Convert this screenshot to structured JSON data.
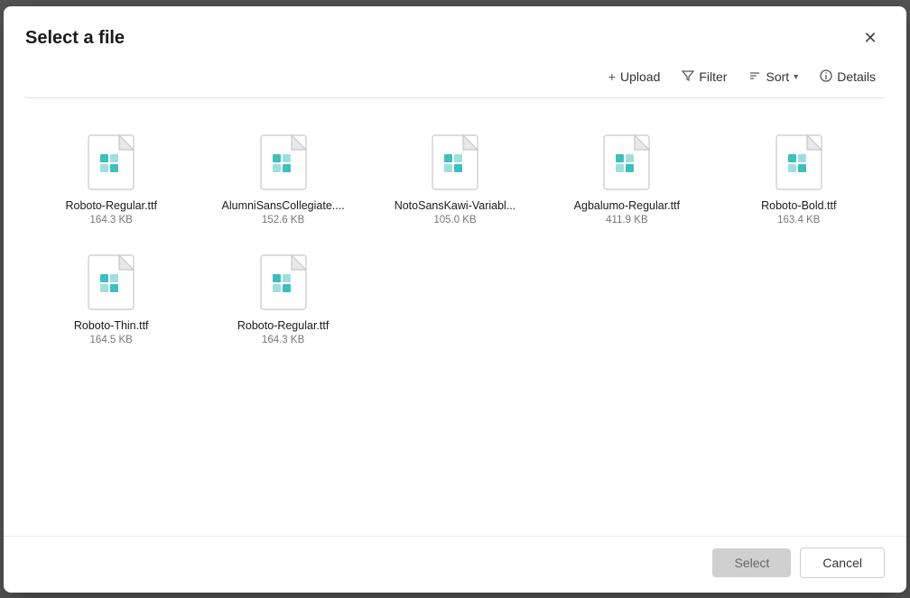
{
  "dialog": {
    "title": "Select a file",
    "close_label": "✕"
  },
  "toolbar": {
    "upload_label": "Upload",
    "filter_label": "Filter",
    "sort_label": "Sort",
    "details_label": "Details"
  },
  "files": [
    {
      "name": "Roboto-Regular.ttf",
      "size": "164.3 KB"
    },
    {
      "name": "AlumniSansCollegiate....",
      "size": "152.6 KB"
    },
    {
      "name": "NotoSansKawi-Variabl...",
      "size": "105.0 KB"
    },
    {
      "name": "Agbalumo-Regular.ttf",
      "size": "411.9 KB"
    },
    {
      "name": "Roboto-Bold.ttf",
      "size": "163.4 KB"
    },
    {
      "name": "Roboto-Thin.ttf",
      "size": "164.5 KB"
    },
    {
      "name": "Roboto-Regular.ttf",
      "size": "164.3 KB"
    }
  ],
  "footer": {
    "select_label": "Select",
    "cancel_label": "Cancel"
  },
  "colors": {
    "icon_teal": "#3dbfbf",
    "icon_border": "#c0c0c0"
  }
}
